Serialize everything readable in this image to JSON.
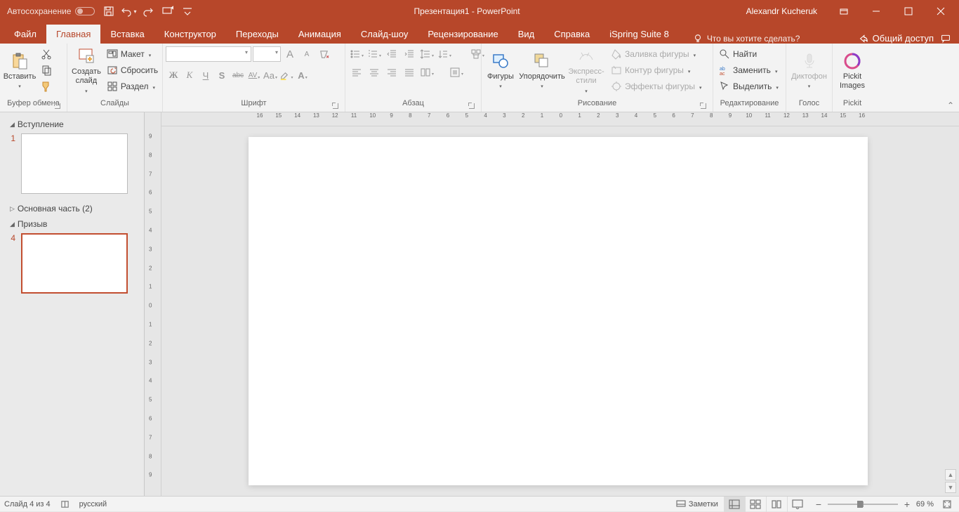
{
  "titlebar": {
    "autosave": "Автосохранение",
    "doc_title": "Презентация1  -  PowerPoint",
    "username": "Alexandr Kucheruk"
  },
  "tabs": {
    "file": "Файл",
    "home": "Главная",
    "insert": "Вставка",
    "design": "Конструктор",
    "transitions": "Переходы",
    "animations": "Анимация",
    "slideshow": "Слайд-шоу",
    "review": "Рецензирование",
    "view": "Вид",
    "help": "Справка",
    "ispring": "iSpring Suite 8",
    "tell_me": "Что вы хотите сделать?",
    "share": "Общий доступ"
  },
  "ribbon": {
    "clipboard": {
      "label": "Буфер обмена",
      "paste": "Вставить"
    },
    "slides": {
      "label": "Слайды",
      "new_slide": "Создать\nслайд",
      "layout": "Макет",
      "reset": "Сбросить",
      "section": "Раздел"
    },
    "font": {
      "label": "Шрифт",
      "bold": "Ж",
      "italic": "К",
      "underline": "Ч",
      "shadow": "S",
      "strike": "abc",
      "spacing": "AV",
      "case": "Aa",
      "grow": "A",
      "shrink": "A",
      "clear": "A"
    },
    "paragraph": {
      "label": "Абзац"
    },
    "drawing": {
      "label": "Рисование",
      "shapes": "Фигуры",
      "arrange": "Упорядочить",
      "quick": "Экспресс-\nстили",
      "fill": "Заливка фигуры",
      "outline": "Контур фигуры",
      "effects": "Эффекты фигуры"
    },
    "editing": {
      "label": "Редактирование",
      "find": "Найти",
      "replace": "Заменить",
      "select": "Выделить"
    },
    "voice": {
      "label": "Голос",
      "dictate": "Диктофон"
    },
    "pickit": {
      "label": "Pickit",
      "images": "Pickit\nImages"
    }
  },
  "outline": {
    "section1": "Вступление",
    "section2": "Основная часть (2)",
    "section3": "Призыв",
    "slide1_num": "1",
    "slide4_num": "4"
  },
  "ruler_h": [
    "16",
    "15",
    "14",
    "13",
    "12",
    "11",
    "10",
    "9",
    "8",
    "7",
    "6",
    "5",
    "4",
    "3",
    "2",
    "1",
    "0",
    "1",
    "2",
    "3",
    "4",
    "5",
    "6",
    "7",
    "8",
    "9",
    "10",
    "11",
    "12",
    "13",
    "14",
    "15",
    "16"
  ],
  "ruler_v": [
    "9",
    "8",
    "7",
    "6",
    "5",
    "4",
    "3",
    "2",
    "1",
    "0",
    "1",
    "2",
    "3",
    "4",
    "5",
    "6",
    "7",
    "8",
    "9"
  ],
  "status": {
    "slide_info": "Слайд 4 из 4",
    "lang": "русский",
    "notes": "Заметки",
    "zoom": "69 %"
  }
}
